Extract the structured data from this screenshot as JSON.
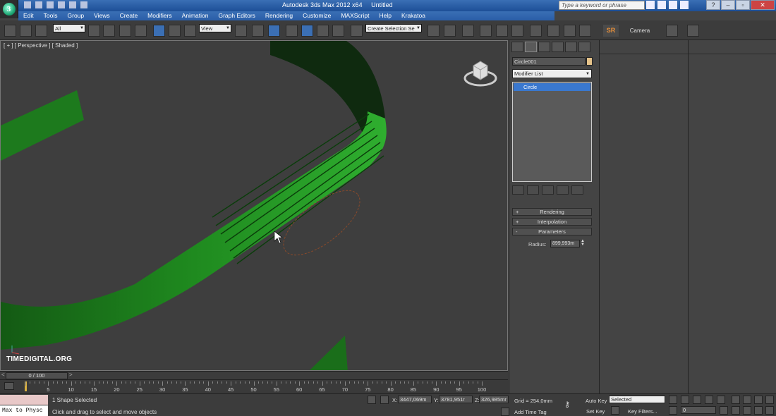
{
  "window": {
    "app_title": "Autodesk 3ds Max 2012 x64",
    "doc_title": "Untitled",
    "search_placeholder": "Type a keyword or phrase"
  },
  "menu": [
    "Edit",
    "Tools",
    "Group",
    "Views",
    "Create",
    "Modifiers",
    "Animation",
    "Graph Editors",
    "Rendering",
    "Customize",
    "MAXScript",
    "Help",
    "Krakatoa"
  ],
  "toolbar": {
    "selection_filter": "All",
    "reference_coord": "View",
    "named_selection": "Create Selection Se",
    "sr_label": "SR",
    "camera_label": "Camera"
  },
  "viewport": {
    "label": "[ + ] [ Perspective ] [ Shaded ]",
    "watermark": "TIMEDIGITAL.ORG"
  },
  "timeline": {
    "frame_display": "0 / 100",
    "left_arrow": "<",
    "right_arrow": ">",
    "ticks": [
      "5",
      "10",
      "15",
      "20",
      "25",
      "30",
      "35",
      "40",
      "45",
      "50",
      "55",
      "60",
      "65",
      "70",
      "75",
      "80",
      "85",
      "90",
      "95",
      "100"
    ]
  },
  "status": {
    "selection": "1 Shape Selected",
    "prompt": "Click and drag to select and move objects",
    "maxscript_out": "Max to Physc",
    "x_label": "X:",
    "x_value": "3447,069m",
    "y_label": "Y:",
    "y_value": "3781,951r",
    "z_label": "Z:",
    "z_value": "326,985mr",
    "grid": "Grid = 254,0mm",
    "add_time_tag": "Add Time Tag",
    "auto_key": "Auto Key",
    "set_key": "Set Key",
    "key_mode": "Selected",
    "key_filters": "Key Filters...",
    "frame_field": "0"
  },
  "command_panel": {
    "object_name": "Circle001",
    "object_color": "#e6c38a",
    "modifier_list": "Modifier List",
    "stack_item": "Circle",
    "rollouts": [
      {
        "sign": "+",
        "label": "Rendering"
      },
      {
        "sign": "+",
        "label": "Interpolation"
      },
      {
        "sign": "-",
        "label": "Parameters"
      }
    ],
    "radius_label": "Radius:",
    "radius_value": "899,993m"
  }
}
